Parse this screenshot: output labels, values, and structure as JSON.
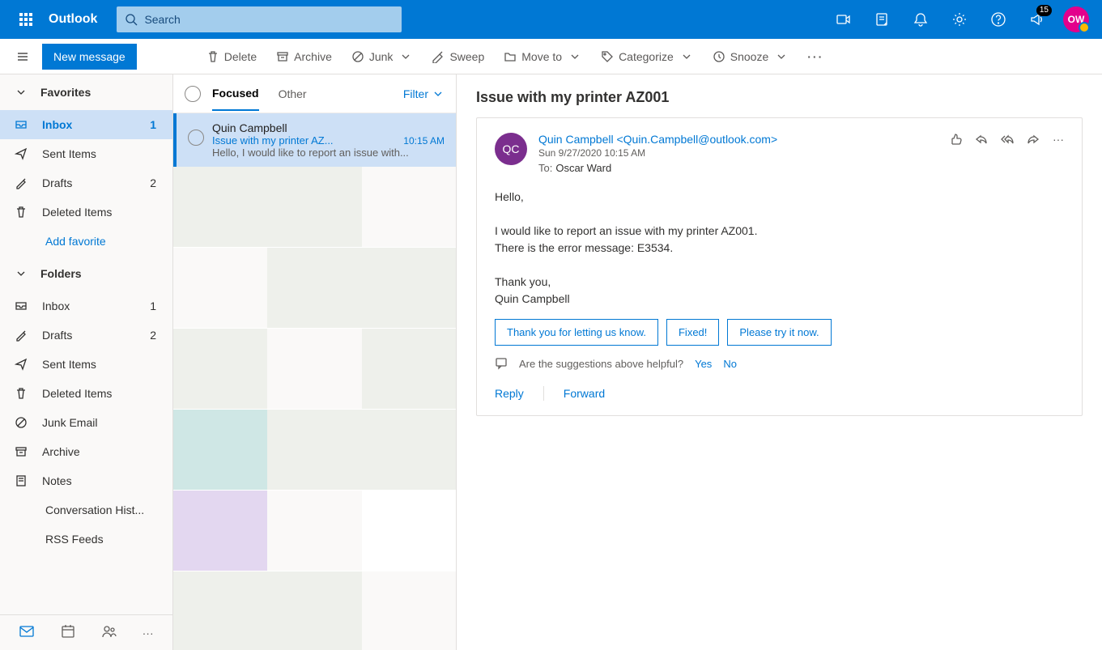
{
  "header": {
    "brand": "Outlook",
    "search_placeholder": "Search",
    "notification_badge": "15",
    "avatar_initials": "OW"
  },
  "commands": {
    "new_message": "New message",
    "delete": "Delete",
    "archive": "Archive",
    "junk": "Junk",
    "sweep": "Sweep",
    "move_to": "Move to",
    "categorize": "Categorize",
    "snooze": "Snooze"
  },
  "sidebar": {
    "favorites_label": "Favorites",
    "folders_label": "Folders",
    "add_favorite": "Add favorite",
    "fav_items": [
      {
        "label": "Inbox",
        "count": "1",
        "icon": "inbox"
      },
      {
        "label": "Sent Items",
        "count": "",
        "icon": "sent"
      },
      {
        "label": "Drafts",
        "count": "2",
        "icon": "drafts"
      },
      {
        "label": "Deleted Items",
        "count": "",
        "icon": "trash"
      }
    ],
    "folder_items": [
      {
        "label": "Inbox",
        "count": "1",
        "icon": "inbox"
      },
      {
        "label": "Drafts",
        "count": "2",
        "icon": "drafts"
      },
      {
        "label": "Sent Items",
        "count": "",
        "icon": "sent"
      },
      {
        "label": "Deleted Items",
        "count": "",
        "icon": "trash"
      },
      {
        "label": "Junk Email",
        "count": "",
        "icon": "junk"
      },
      {
        "label": "Archive",
        "count": "",
        "icon": "archive"
      },
      {
        "label": "Notes",
        "count": "",
        "icon": "notes"
      },
      {
        "label": "Conversation Hist...",
        "count": "",
        "icon": "none"
      },
      {
        "label": "RSS Feeds",
        "count": "",
        "icon": "none"
      }
    ]
  },
  "msglist": {
    "tabs": {
      "focused": "Focused",
      "other": "Other",
      "filter": "Filter"
    },
    "items": [
      {
        "from": "Quin Campbell",
        "subject": "Issue with my printer AZ...",
        "time": "10:15 AM",
        "preview": "Hello, I would like to report an issue with..."
      }
    ]
  },
  "reading": {
    "subject": "Issue with my printer AZ001",
    "sender_initials": "QC",
    "sender_display": "Quin Campbell <Quin.Campbell@outlook.com>",
    "sent": "Sun 9/27/2020 10:15 AM",
    "to_label": "To:",
    "to_value": "Oscar Ward",
    "body": "Hello,\n\nI would like to report an issue with my printer AZ001.\nThere is the error message: E3534.\n\nThank you,\nQuin Campbell",
    "suggestions": [
      "Thank you for letting us know.",
      "Fixed!",
      "Please try it now."
    ],
    "feedback_q": "Are the suggestions above helpful?",
    "feedback_yes": "Yes",
    "feedback_no": "No",
    "reply": "Reply",
    "forward": "Forward"
  },
  "placeholder_colors": [
    [
      "#eef0eb",
      "#eef0eb",
      "#faf9f8"
    ],
    [
      "#faf9f8",
      "#eef0eb",
      "#eef0eb"
    ],
    [
      "#eef0eb",
      "#faf9f8",
      "#eef0eb"
    ],
    [
      "#cfe7e5",
      "#eef0eb",
      "#eef0eb"
    ],
    [
      "#e3d7f0",
      "#faf9f8",
      "#ffffff"
    ],
    [
      "#eef0eb",
      "#eef0eb",
      "#faf9f8"
    ]
  ]
}
